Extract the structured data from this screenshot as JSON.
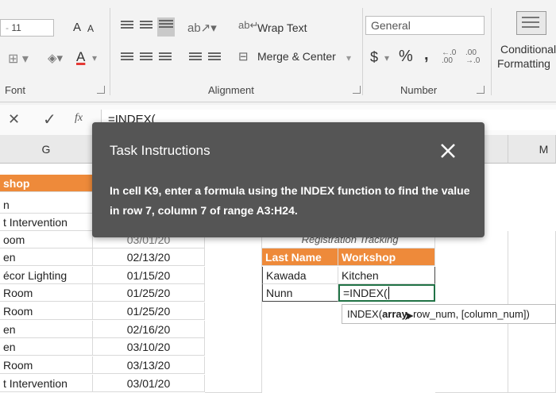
{
  "ribbon": {
    "font_size": "11",
    "grow_font": "A",
    "shrink_font": "A",
    "font_color_letter": "A",
    "wrap_text": "Wrap Text",
    "merge_center": "Merge & Center",
    "number_format": "General",
    "currency": "$",
    "percent": "%",
    "comma": ",",
    "inc_decimal": "←.0 .00",
    "dec_decimal": ".00 →.0",
    "conditional_line1": "Conditional",
    "conditional_line2": "Formatting",
    "group_font": "Font",
    "group_alignment": "Alignment",
    "group_number": "Number"
  },
  "formula_bar": {
    "cancel_glyph": "✕",
    "enter_glyph": "✓",
    "fx_label": "fx",
    "formula": "=INDEX("
  },
  "columns": {
    "g": "G",
    "m": "M"
  },
  "column_g_cells": [
    "shop",
    "n",
    "t Intervention",
    "oom",
    "en",
    "écor Lighting",
    "Room",
    "Room",
    "en",
    "en",
    "Room",
    "t Intervention"
  ],
  "dates": [
    "03/01/20",
    "02/13/20",
    "01/15/20",
    "01/25/20",
    "01/25/20",
    "02/16/20",
    "03/10/20",
    "03/13/20",
    "03/01/20"
  ],
  "registration_title": "Registration Tracking",
  "table": {
    "header_last_name": "Last Name",
    "header_workshop": "Workshop",
    "rows": [
      {
        "last_name": "Kawada",
        "workshop": "Kitchen"
      },
      {
        "last_name": "Nunn",
        "workshop": "=INDEX("
      }
    ]
  },
  "tooltip": {
    "func": "INDEX(",
    "arg_bold": "array",
    "rest": ", row_num, [column_num])"
  },
  "dialog": {
    "title": "Task Instructions",
    "body": "In cell K9, enter a formula using the INDEX function to find the value in row 7, column 7 of range A3:H24."
  },
  "colors": {
    "accent_orange": "#ee8a3a",
    "dialog_bg": "#555555"
  }
}
